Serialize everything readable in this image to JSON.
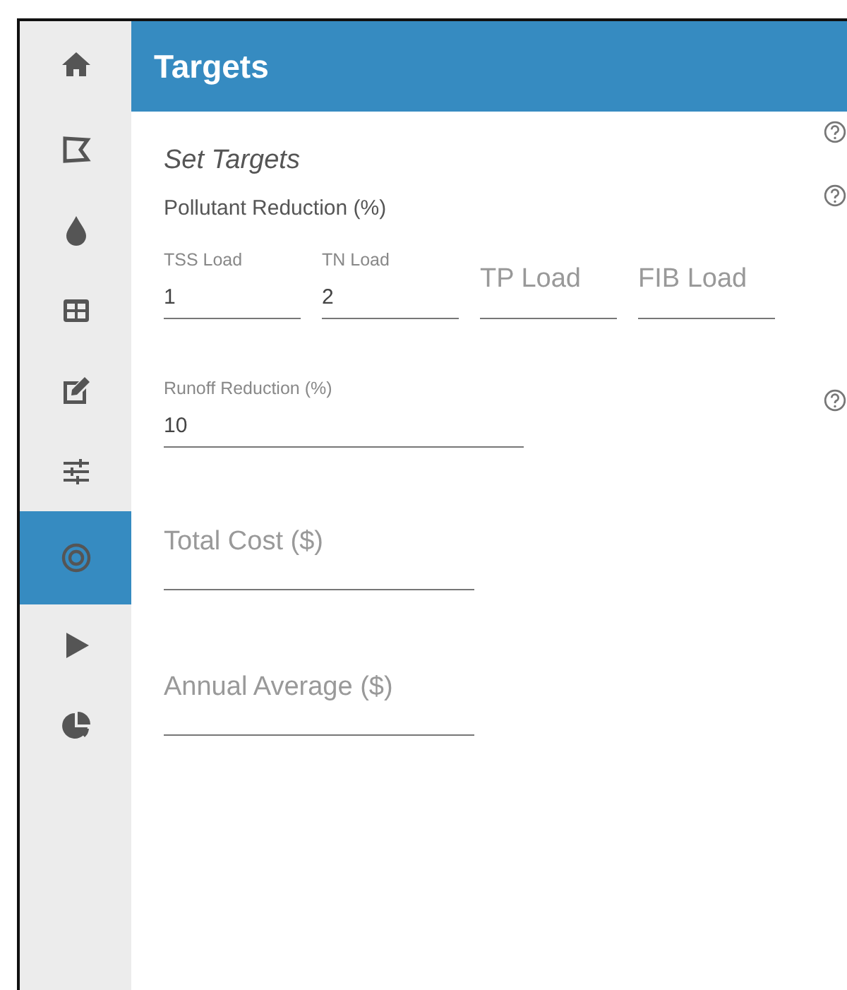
{
  "sidebar": {
    "items": [
      {
        "kind": "home",
        "selected": false
      },
      {
        "kind": "shape",
        "selected": false
      },
      {
        "kind": "drop",
        "selected": false
      },
      {
        "kind": "grid",
        "selected": false
      },
      {
        "kind": "edit",
        "selected": false
      },
      {
        "kind": "sliders",
        "selected": false
      },
      {
        "kind": "target",
        "selected": true
      },
      {
        "kind": "play",
        "selected": false
      },
      {
        "kind": "pie",
        "selected": false
      }
    ]
  },
  "header": {
    "title": "Targets"
  },
  "section_title": "Set Targets",
  "pollutant_reduction": {
    "label": "Pollutant Reduction (%)",
    "fields": [
      {
        "label": "TSS Load",
        "value": "1"
      },
      {
        "label": "TN Load",
        "value": "2"
      },
      {
        "label": "TP Load"
      },
      {
        "label": "FIB Load"
      }
    ]
  },
  "runoff_reduction": {
    "label": "Runoff Reduction (%)",
    "value": "10"
  },
  "total_cost": {
    "label": "Total Cost ($)"
  },
  "annual_average": {
    "label": "Annual Average ($)"
  }
}
